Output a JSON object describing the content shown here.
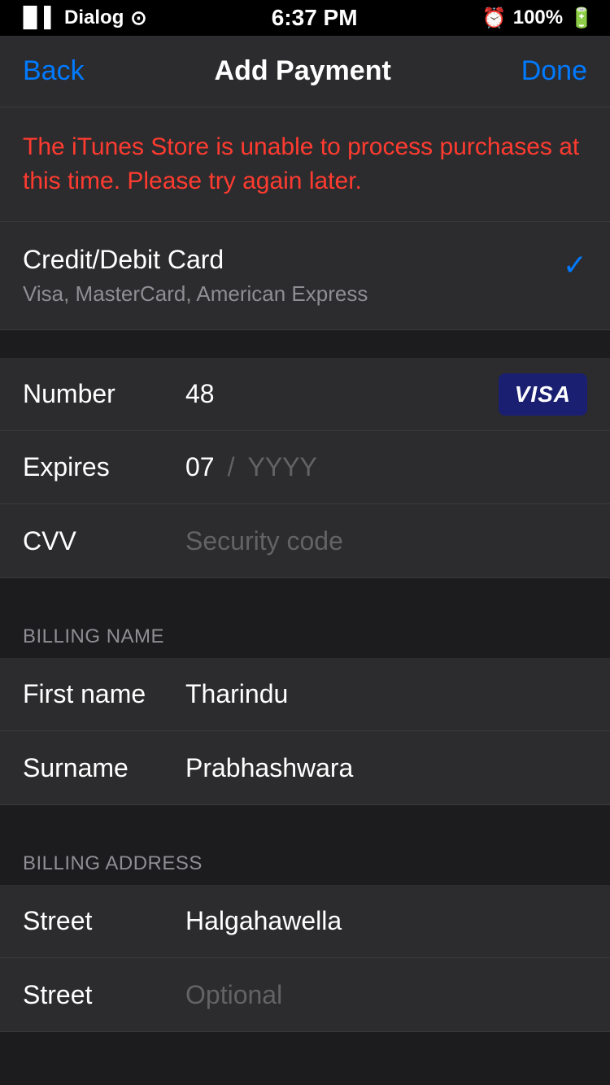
{
  "statusBar": {
    "carrier": "Dialog",
    "time": "6:37 PM",
    "battery": "100%"
  },
  "navBar": {
    "backLabel": "Back",
    "title": "Add Payment",
    "doneLabel": "Done"
  },
  "errorBanner": {
    "message": "The iTunes Store is unable to process purchases at this time. Please try again later."
  },
  "paymentMethod": {
    "title": "Credit/Debit Card",
    "subtitle": "Visa, MasterCard, American Express",
    "selected": true
  },
  "cardForm": {
    "numberLabel": "Number",
    "numberValue": "48",
    "expiresLabel": "Expires",
    "expiresMonth": "07",
    "expiresYearPlaceholder": "YYYY",
    "cvvLabel": "CVV",
    "cvvPlaceholder": "Security code",
    "visaBadge": "VISA"
  },
  "billingName": {
    "sectionHeader": "BILLING NAME",
    "firstNameLabel": "First name",
    "firstNameValue": "Tharindu",
    "surnameLabel": "Surname",
    "surnameValue": "Prabhashwara"
  },
  "billingAddress": {
    "sectionHeader": "BILLING ADDRESS",
    "streetLabel": "Street",
    "streetValue": "Halgahawella",
    "street2Label": "Street",
    "street2Placeholder": "Optional"
  }
}
